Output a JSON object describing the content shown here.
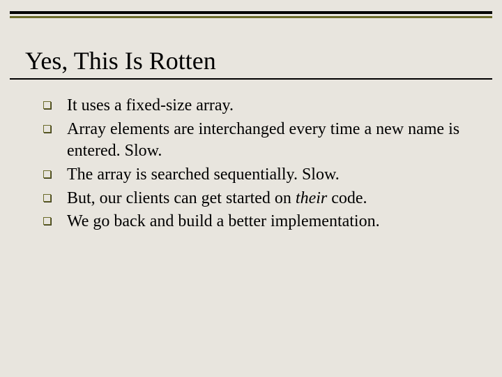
{
  "slide": {
    "title": "Yes, This Is Rotten",
    "bullets": [
      {
        "text": "It uses a fixed-size array."
      },
      {
        "text": "Array elements are interchanged every time a new name is entered.  Slow."
      },
      {
        "text": "The array is searched sequentially.  Slow."
      },
      {
        "prefix": "But, our clients can get started on ",
        "italic": "their",
        "suffix": " code."
      },
      {
        "text": "We go back and build a better implementation."
      }
    ]
  }
}
